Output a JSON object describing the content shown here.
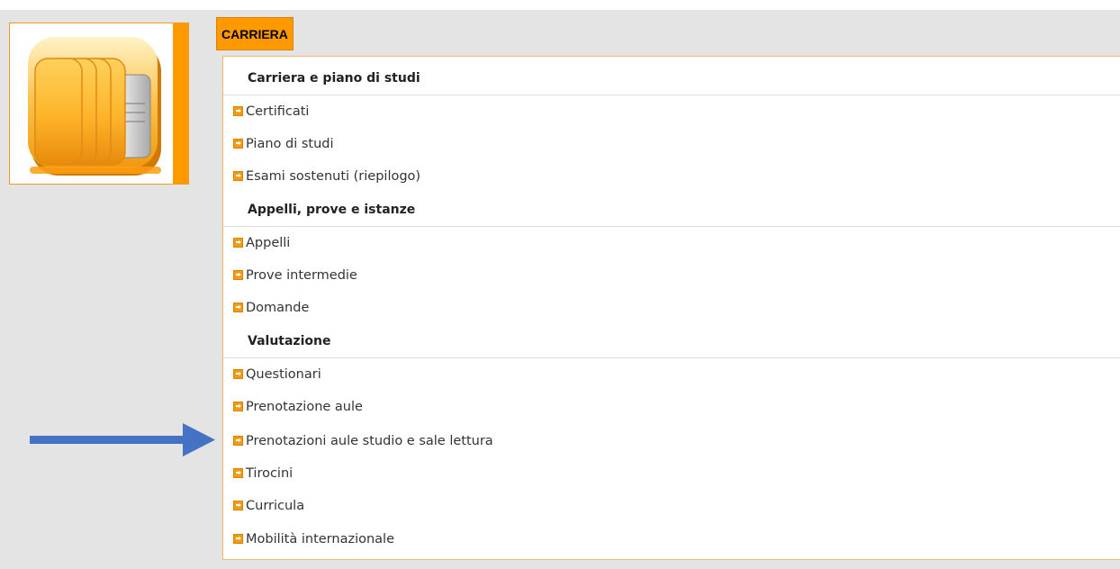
{
  "section": {
    "title": "CARRIERA",
    "accent": "#ff9900"
  },
  "icon": {
    "name": "folder-stack-icon"
  },
  "groups": [
    {
      "title": "Carriera e piano di studi",
      "items": [
        "Certificati",
        "Piano di studi",
        "Esami sostenuti (riepilogo)"
      ]
    },
    {
      "title": "Appelli, prove e istanze",
      "items": [
        "Appelli",
        "Prove intermedie",
        "Domande"
      ]
    },
    {
      "title": "Valutazione",
      "items": [
        "Questionari",
        "Prenotazione aule",
        "Prenotazioni aule studio e sale lettura",
        "Tirocini",
        "Curricula",
        "Mobilità internazionale"
      ]
    }
  ],
  "annotation": {
    "color": "#4472c4",
    "target_item": "Prenotazioni aule studio e sale lettura"
  }
}
